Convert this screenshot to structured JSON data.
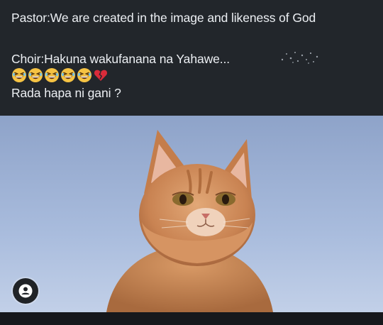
{
  "post": {
    "line1": "Pastor:We are created in the image and likeness of God",
    "line2": "Choir:Hakuna wakufanana na Yahawe...",
    "line3_emojis": [
      "grinning-squinting-face",
      "grinning-squinting-face",
      "grinning-squinting-face",
      "grinning-squinting-face",
      "grinning-squinting-face",
      "broken-heart"
    ],
    "line4": "Rada hapa ni gani ?",
    "sparkle_icon": "sparkles-icon"
  },
  "image": {
    "subject": "ginger-kitten-photo",
    "sky_color": "#9fb4d6",
    "fur_color": "#cf8a58"
  },
  "overlay": {
    "icon": "user-avatar-icon"
  },
  "colors": {
    "panel_bg": "#22262b",
    "text": "#eceff3",
    "emoji_yellow": "#f6c343",
    "heart_red": "#d92b3a"
  }
}
